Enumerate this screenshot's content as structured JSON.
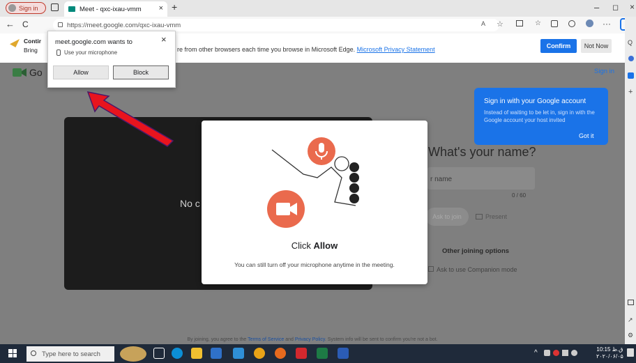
{
  "browser": {
    "signin_label": "Sign in",
    "tab_title": "Meet - qxc-ixau-vmm",
    "tab_close": "×",
    "new_tab": "+",
    "url": "https://meet.google.com/qxc-ixau-vmm",
    "nav_back": "←",
    "nav_reload": "C",
    "win_min": "–",
    "win_max": "◻",
    "win_close": "×"
  },
  "infobar": {
    "heading": "Contir",
    "line": "Bring",
    "message": "re from other browsers each time you browse in Microsoft Edge.",
    "link": "Microsoft Privacy Statement",
    "confirm_label": "Confirm",
    "not_now_label": "Not Now"
  },
  "permission_popup": {
    "title": "meet.google.com wants to",
    "permission": "Use your microphone",
    "allow_label": "Allow",
    "block_label": "Block",
    "close": "×"
  },
  "meet": {
    "logo_text": "Go",
    "signin_link": "Sign in",
    "no_camera": "No c",
    "name_title": "What's your name?",
    "name_placeholder": "r name",
    "name_counter": "0 / 60",
    "ask_to_join": "Ask to join",
    "present": "Present",
    "other_options": "Other joining options",
    "companion": "Ask to use Companion mode",
    "footer_pre": "By joining, you agree to the",
    "footer_terms": "Terms of Service",
    "footer_and": "and",
    "footer_privacy": "Privacy Policy",
    "footer_post": ". System info will be sent to confirm you're not a bot."
  },
  "tooltip": {
    "title": "Sign in with your Google account",
    "body": "Instead of waiting to be let in, sign in with the Google account your host invited",
    "got_it": "Got it"
  },
  "modal": {
    "title_prefix": "Click ",
    "title_bold": "Allow",
    "body": "You can still turn off your microphone anytime in the meeting."
  },
  "taskbar": {
    "search_placeholder": "Type here to search",
    "time": "10:15 ق.ظ",
    "date": "۲۰۲۰/۰۶/۰۵"
  },
  "colors": {
    "accent": "#1a73e8",
    "modal_icon": "#ea6a4d",
    "arrow": "#e8141e"
  }
}
